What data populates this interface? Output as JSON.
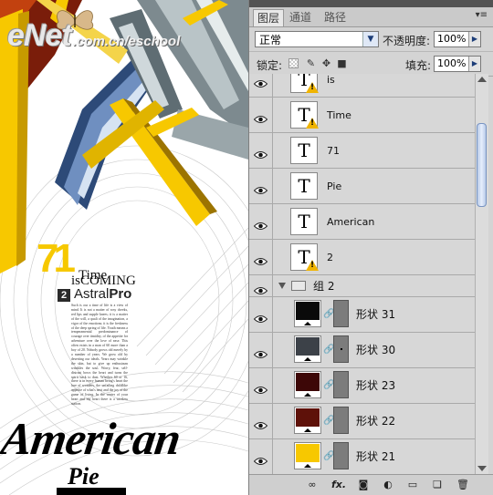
{
  "artwork": {
    "logo_main": "eNet",
    "logo_sub": ".com.cn/eschool",
    "big_number": "71",
    "title_line1": "Time",
    "title_line2": "isCOMING",
    "issue_number": "2",
    "astral_a": "Astral",
    "astral_b": "Pro",
    "body_text": "Such is our a time of life is a view of mind. It is not a matter of rosy cheeks, red lips and supple knees; it is a matter of the will, a quali of the imagination, a vigor of the emotions; it is the freshness of the deep spring of life. Youth means a temperamental predominance of courage over timidity, of the appetite for adventure over the love of ease. This often exists in a man of 60 more than a boy of 20. Nobody grows old merely by a number of years. We grow old by deserting our ideals. Years may wrinkle the skin, but to give up enthusiasm wrinkles the soul. Worry, fear, self-distrust bows the heart and turns the spirit back to dust. Whether 60 or 16, there is in every human being's heart the lure of wonders, the unfailing childlike appetite of what's next and the joy of the game of living. In the center of your heart and my heart there is a wireless station.",
    "headline": "American",
    "subheadline": "Pie"
  },
  "panel": {
    "tabs": [
      "图层",
      "通道",
      "路径"
    ],
    "menu_icon": "panel-menu-icon",
    "blend_mode": "正常",
    "opacity_label": "不透明度:",
    "opacity_value": "100%",
    "lock_label": "锁定:",
    "fill_label": "填充:",
    "fill_value": "100%",
    "text_layers": [
      {
        "name": "is",
        "warning": true
      },
      {
        "name": "Time",
        "warning": true
      },
      {
        "name": "71",
        "warning": false
      },
      {
        "name": "Pie",
        "warning": false
      },
      {
        "name": "American",
        "warning": false
      },
      {
        "name": "2",
        "warning": true
      }
    ],
    "group": {
      "name": "组 2",
      "expanded": true
    },
    "shape_layers": [
      {
        "name": "形状 31",
        "color": "#0a0a0a",
        "selected_dot": false
      },
      {
        "name": "形状 30",
        "color": "#3c4148",
        "selected_dot": true
      },
      {
        "name": "形状 23",
        "color": "#3d0707",
        "selected_dot": false
      },
      {
        "name": "形状 22",
        "color": "#5e1109",
        "selected_dot": false
      },
      {
        "name": "形状 21",
        "color": "#f7c800",
        "selected_dot": false
      }
    ],
    "thumb_glyph": "T",
    "bottom_icons": [
      "link-layers-icon",
      "fx-icon",
      "add-mask-icon",
      "adjustment-layer-icon",
      "new-group-icon",
      "new-layer-icon",
      "trash-icon"
    ],
    "fx_label": "fx."
  }
}
